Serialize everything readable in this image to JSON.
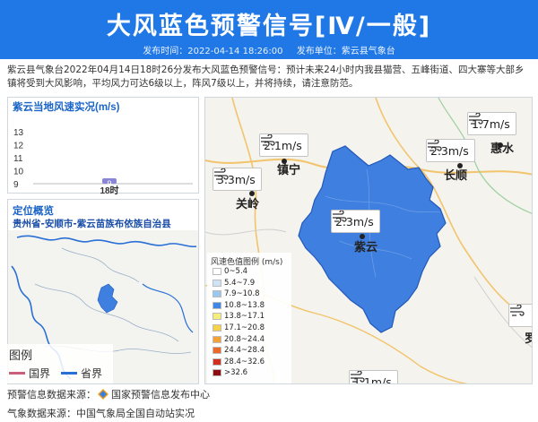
{
  "header": {
    "title": "大风蓝色预警信号[Ⅳ/一般]",
    "publish_time": "发布时间：2022-04-14 18:26:00",
    "publisher": "发布单位：紫云县气象台"
  },
  "description": "紫云县气象台2022年04月14日18时26分发布大风蓝色预警信号：预计未来24小时内我县猫营、五峰街道、四大寨等大部乡镇将受到大风影响，平均风力可达6级以上，阵风7级以上，并将持续，请注意防范。",
  "wind_panel": {
    "title": "紫云当地风速实况(m/s)"
  },
  "chart_data": {
    "type": "bar",
    "categories": [
      "18时"
    ],
    "values": [
      9
    ],
    "yticks": [
      "13",
      "12",
      "11",
      "10",
      "9"
    ],
    "ylim": [
      9,
      13
    ],
    "color": "#8a86d6"
  },
  "overview": {
    "title": "定位概览",
    "region": "贵州省-安顺市-紫云苗族布依族自治县",
    "legend_title": "图例",
    "legend_items": [
      {
        "label": "国界",
        "color": "#c9607a"
      },
      {
        "label": "省界",
        "color": "#2a6fd6"
      }
    ]
  },
  "stations": [
    {
      "speed": "2.1m/s"
    },
    {
      "speed": "3.3m/s"
    },
    {
      "speed": "2.3m/s"
    },
    {
      "speed": "1.7m/s"
    },
    {
      "speed": "2.3m/s"
    },
    {
      "speed": "1.1m/s"
    }
  ],
  "cities": [
    "镇宁",
    "关岭",
    "紫云",
    "长顺",
    "惠水",
    "罗"
  ],
  "wind_legend": {
    "title": "风速色值图例 (m/s)",
    "items": [
      {
        "label": "0~5.4",
        "color": "#ffffff"
      },
      {
        "label": "5.4~7.9",
        "color": "#cfe3f7"
      },
      {
        "label": "7.9~10.8",
        "color": "#9cc8f0"
      },
      {
        "label": "10.8~13.8",
        "color": "#3f86e6"
      },
      {
        "label": "13.8~17.1",
        "color": "#f6ee7a"
      },
      {
        "label": "17.1~20.8",
        "color": "#f6d24a"
      },
      {
        "label": "20.8~24.4",
        "color": "#f3a23a"
      },
      {
        "label": "24.4~28.4",
        "color": "#ea6a2a"
      },
      {
        "label": "28.4~32.6",
        "color": "#d2301e"
      },
      {
        "label": ">32.6",
        "color": "#8b0d0d"
      }
    ]
  },
  "footer": {
    "warning_source": "预警信息数据来源：",
    "warning_source_name": "国家预警信息发布中心",
    "weather_source": "气象数据来源：中国气象局全国自动站实况"
  },
  "colors": {
    "header": "#1f78e5",
    "county_fill": "#3f7fe0",
    "accent": "#1a64c8"
  }
}
